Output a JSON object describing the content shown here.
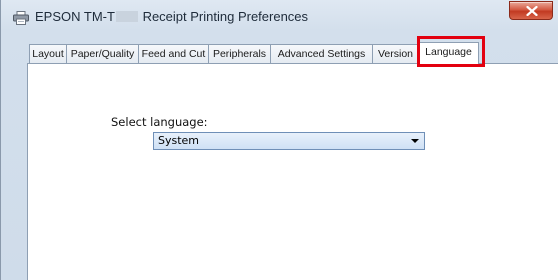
{
  "window": {
    "title_prefix": "EPSON TM-T",
    "title_suffix": "Receipt Printing Preferences",
    "title_redacted": true,
    "icon": "printer-icon",
    "close_icon": "close-icon"
  },
  "tabs": [
    {
      "label": "Layout",
      "active": false
    },
    {
      "label": "Paper/Quality",
      "active": false
    },
    {
      "label": "Feed and Cut",
      "active": false
    },
    {
      "label": "Peripherals",
      "active": false
    },
    {
      "label": "Advanced Settings",
      "active": false
    },
    {
      "label": "Version",
      "active": false
    },
    {
      "label": "Language",
      "active": true,
      "highlighted": true
    }
  ],
  "language_panel": {
    "select_label": "Select language:",
    "selected_value": "System",
    "dropdown_icon": "chevron-down-icon"
  },
  "colors": {
    "highlight": "#e3000f",
    "close_button": "#c23a22",
    "combo_border": "#6f8fb7"
  }
}
